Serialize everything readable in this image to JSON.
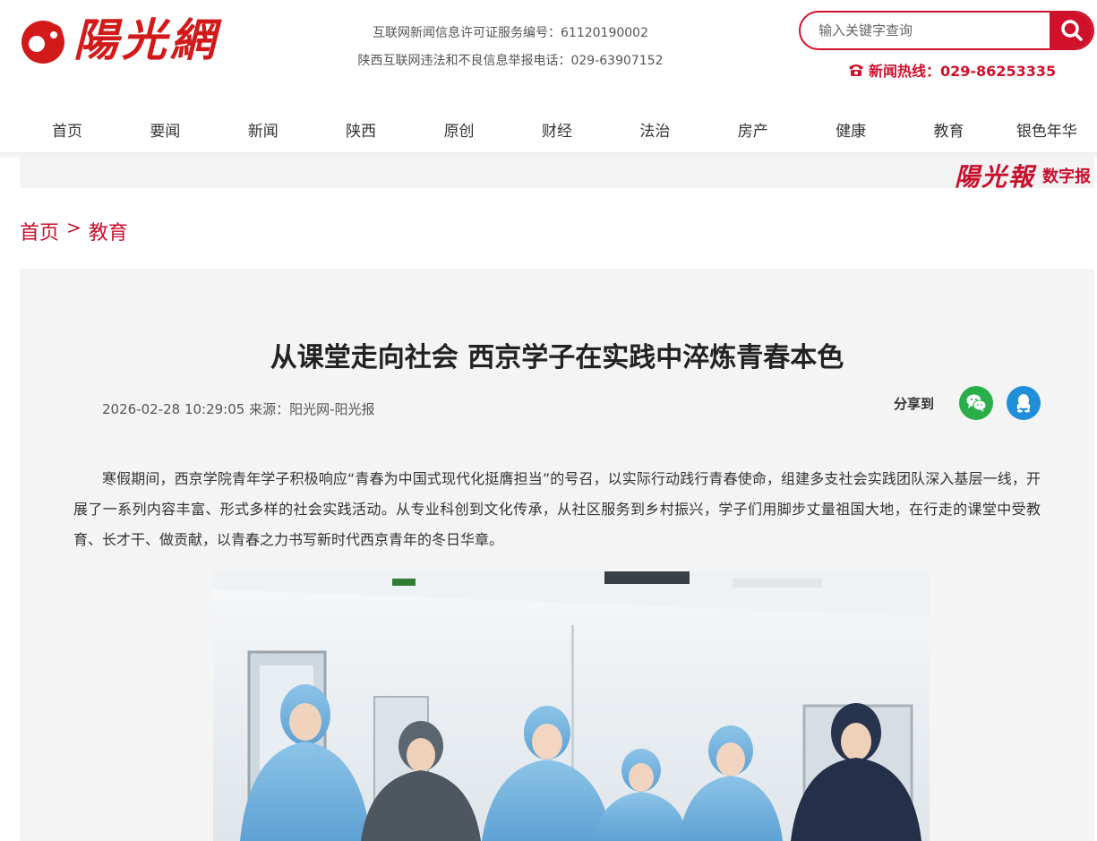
{
  "site": {
    "logo_text": "陽光網"
  },
  "header": {
    "license_line1": "互联网新闻信息许可证服务编号：61120190002",
    "license_line2": "陕西互联网违法和不良信息举报电话：029-63907152",
    "search_placeholder": "输入关键字查询",
    "hotline": "新闻热线：029-86253335"
  },
  "nav": {
    "items": [
      "首页",
      "要闻",
      "新闻",
      "陕西",
      "原创",
      "财经",
      "法治",
      "房产",
      "健康",
      "教育",
      "银色年华"
    ]
  },
  "digital": {
    "brand": "陽光報",
    "label": "数字报"
  },
  "breadcrumb": {
    "home": "首页",
    "sep": ">",
    "current": "教育"
  },
  "article": {
    "title": "从课堂走向社会 西京学子在实践中淬炼青春本色",
    "meta": "2026-02-28 10:29:05 来源：阳光网-阳光报",
    "share_label": "分享到",
    "paragraph": "寒假期间，西京学院青年学子积极响应“青春为中国式现代化挺膺担当”的号召，以实际行动践行青春使命，组建多支社会实践团队深入基层一线，开展了一系列内容丰富、形式多样的社会实践活动。从专业科创到文化传承，从社区服务到乡村振兴，学子们用脚步丈量祖国大地，在行走的课堂中受教育、长才干、做贡献，以青春之力书写新时代西京青年的冬日华章。"
  },
  "colors": {
    "brand_red": "#d0112b",
    "wechat_green": "#2aae4a",
    "qq_blue": "#1e8fd8"
  }
}
